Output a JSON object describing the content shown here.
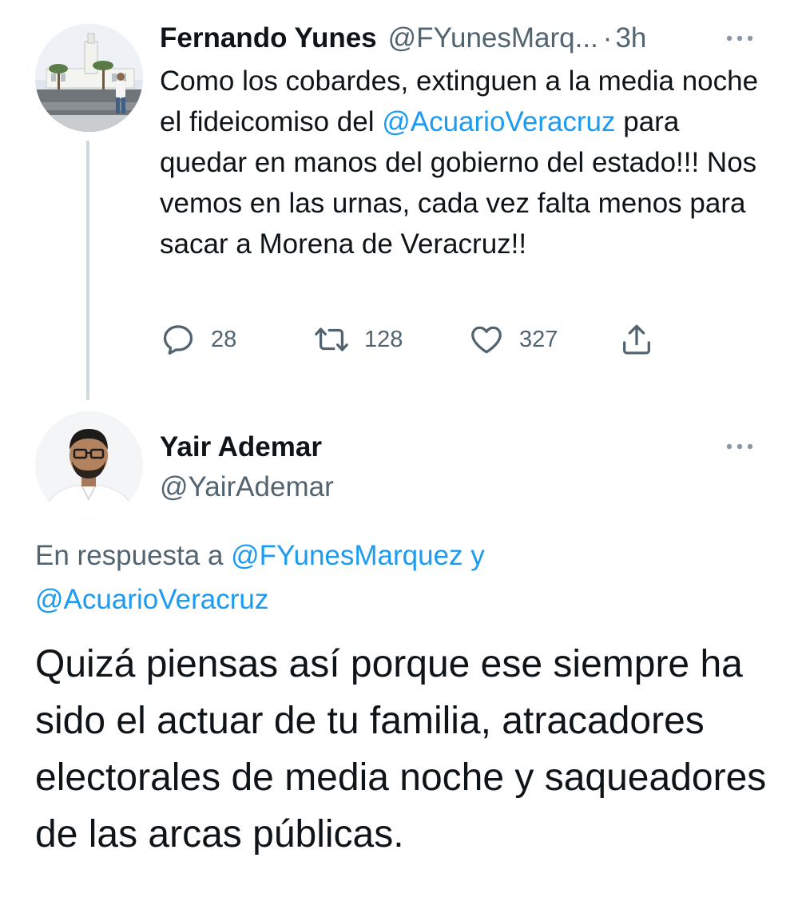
{
  "parent_tweet": {
    "author_name": "Fernando Yunes",
    "author_handle": "@FYunesMarq...",
    "separator": "·",
    "time": "3h",
    "more_icon": "ellipsis-icon",
    "text_segments": [
      {
        "text": "Como los cobardes, extinguen a la media noche el fideicomiso del ",
        "mention": false
      },
      {
        "text": "@AcuarioVeracruz",
        "mention": true
      },
      {
        "text": " para quedar en manos del gobierno del estado!!! Nos vemos en las urnas, cada vez falta menos para sacar a Morena de Veracruz!!",
        "mention": false
      }
    ],
    "actions": {
      "reply": {
        "icon": "reply-icon",
        "count": "28"
      },
      "retweet": {
        "icon": "retweet-icon",
        "count": "128"
      },
      "like": {
        "icon": "heart-icon",
        "count": "327"
      },
      "share": {
        "icon": "share-icon"
      }
    }
  },
  "reply_tweet": {
    "author_name": "Yair Ademar",
    "author_handle": "@YairAdemar",
    "more_icon": "ellipsis-icon",
    "context_prefix": "En respuesta a ",
    "context_mention_1": "@FYunesMarquez",
    "context_joiner": " y",
    "context_mention_2": "@AcuarioVeracruz",
    "text": "Quizá piensas así porque ese siempre ha sido el actuar de tu familia, atracadores electorales de media noche y saqueadores de las arcas públicas."
  },
  "colors": {
    "text_primary": "#0f1419",
    "text_secondary": "#536471",
    "accent": "#1d9bf0",
    "thread_line": "#cfd9de"
  }
}
